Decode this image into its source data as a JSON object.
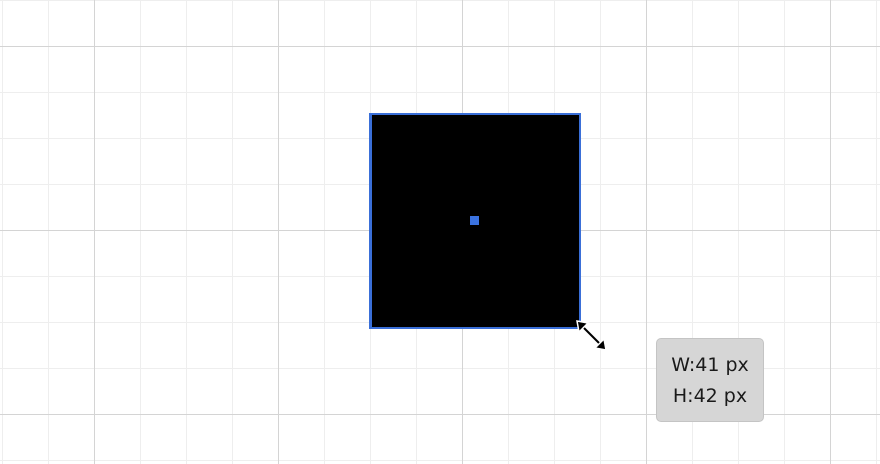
{
  "shape": {
    "fill_color": "#000000",
    "selection_color": "#3a6fd8"
  },
  "cursor": {
    "icon": "resize-diagonal-icon"
  },
  "tooltip": {
    "width_text": "W:41 px",
    "height_text": "H:42 px"
  }
}
